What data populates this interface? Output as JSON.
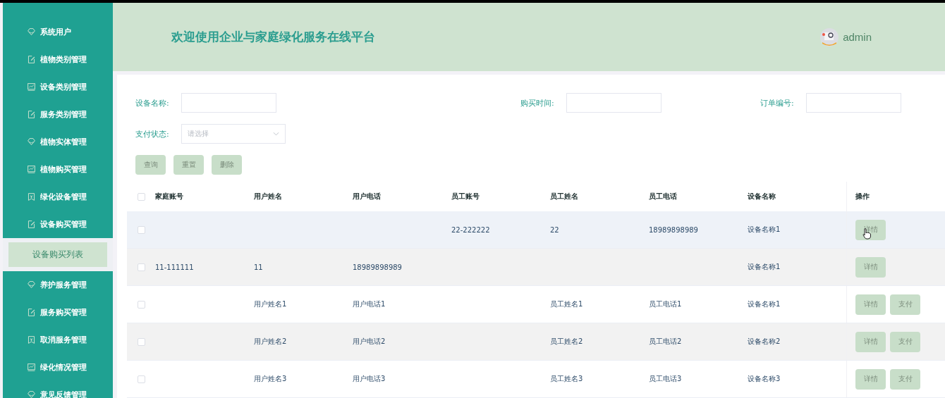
{
  "sidebar": {
    "items": [
      {
        "label": "系统用户",
        "kind": "diamond",
        "selected": false
      },
      {
        "label": "植物类别管理",
        "kind": "edit",
        "selected": false
      },
      {
        "label": "设备类别管理",
        "kind": "chart",
        "selected": false
      },
      {
        "label": "服务类别管理",
        "kind": "edit",
        "selected": false
      },
      {
        "label": "植物实体管理",
        "kind": "diamond",
        "selected": false
      },
      {
        "label": "植物购买管理",
        "kind": "chart",
        "selected": false
      },
      {
        "label": "绿化设备管理",
        "kind": "receipt",
        "selected": false
      },
      {
        "label": "设备购买管理",
        "kind": "edit",
        "selected": false,
        "expanded": true,
        "children": [
          {
            "label": "设备购买列表",
            "selected": true
          }
        ]
      },
      {
        "label": "养护服务管理",
        "kind": "diamond",
        "selected": false
      },
      {
        "label": "服务购买管理",
        "kind": "edit",
        "selected": false
      },
      {
        "label": "取消服务管理",
        "kind": "receipt",
        "selected": false
      },
      {
        "label": "绿化情况管理",
        "kind": "chart",
        "selected": false
      },
      {
        "label": "意见反馈管理",
        "kind": "diamond",
        "selected": false
      }
    ]
  },
  "header": {
    "title": "欢迎使用企业与家庭绿化服务在线平台",
    "user": "admin"
  },
  "search": {
    "fields": [
      {
        "label": "设备名称:",
        "kind": "text"
      },
      {
        "label": "购买时间:",
        "kind": "text"
      },
      {
        "label": "订单编号:",
        "kind": "text"
      },
      {
        "label": "支付状态:",
        "kind": "select",
        "placeholder": "请选择"
      }
    ],
    "buttons": [
      "查询",
      "重置",
      "删除"
    ]
  },
  "table": {
    "all_checked": false,
    "columns": [
      "家庭账号",
      "用户姓名",
      "用户电话",
      "员工账号",
      "员工姓名",
      "员工电话",
      "设备名称",
      "操作"
    ],
    "rows": [
      {
        "hovered": true,
        "checked": false,
        "cells": [
          null,
          null,
          null,
          "22-222222",
          "22",
          "18989898989",
          "设备名称1"
        ],
        "actions": [
          "详情"
        ]
      },
      {
        "hovered": false,
        "checked": false,
        "cells": [
          "11-111111",
          "11",
          "18989898989",
          null,
          null,
          null,
          "设备名称1"
        ],
        "actions": [
          "详情"
        ]
      },
      {
        "hovered": false,
        "checked": false,
        "cells": [
          null,
          "用户姓名1",
          "用户电话1",
          null,
          "员工姓名1",
          "员工电话1",
          "设备名称1"
        ],
        "actions": [
          "详情",
          "支付"
        ]
      },
      {
        "hovered": false,
        "checked": false,
        "cells": [
          null,
          "用户姓名2",
          "用户电话2",
          null,
          "员工姓名2",
          "员工电话2",
          "设备名称2"
        ],
        "actions": [
          "详情",
          "支付"
        ]
      },
      {
        "hovered": false,
        "checked": false,
        "cells": [
          null,
          "用户姓名3",
          "用户电话3",
          null,
          "员工姓名3",
          "员工电话3",
          "设备名称3"
        ],
        "actions": [
          "详情",
          "支付"
        ]
      }
    ]
  }
}
